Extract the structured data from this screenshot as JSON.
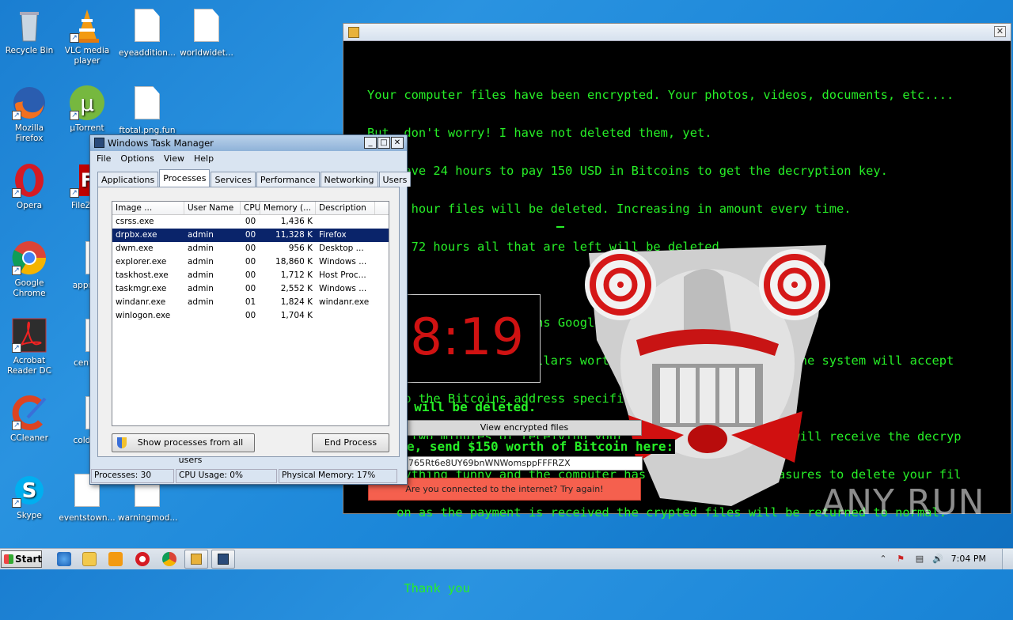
{
  "desktop": {
    "icons": [
      {
        "label": "Recycle Bin"
      },
      {
        "label": "VLC media player"
      },
      {
        "label": "eyeaddition..."
      },
      {
        "label": "worldwidet..."
      },
      {
        "label": "Mozilla Firefox"
      },
      {
        "label": "µTorrent"
      },
      {
        "label": "ftotal.png.fun"
      },
      {
        "label": "Opera"
      },
      {
        "label": "FileZilla"
      },
      {
        "label": "Google Chrome"
      },
      {
        "label": "approv"
      },
      {
        "label": "Acrobat Reader DC"
      },
      {
        "label": "center"
      },
      {
        "label": "CCleaner"
      },
      {
        "label": "coldne"
      },
      {
        "label": "Skype"
      },
      {
        "label": "eventstown..."
      },
      {
        "label": "warningmod..."
      }
    ]
  },
  "ransom": {
    "message_lines": [
      "Your computer files have been encrypted. Your photos, videos, documents, etc....",
      "But, don't worry! I have not deleted them, yet.",
      "You have 24 hours to pay 150 USD in Bitcoins to get the decryption key.",
      "Every hour files will be deleted. Increasing in amount every time.",
      "After 72 hours all that are left will be deleted.",
      "",
      "   u do not have bitcoins Google the website localbitcoins.",
      "    ase 150 American Dollars worth of Bitcoins or .4 BTC. The system will accept",
      "    to the Bitcoins address specified.",
      "    n two minutes of receiving your payment your computer will receive the decryp",
      "    nything funny and the computer has several safety measures to delete your fil",
      "    on as the payment is received the crypted files will be returned to normal.",
      "",
      "     Thank you"
    ],
    "timer": "8:19",
    "deleted_text": "e will be deleted.",
    "view_button": "View encrypted files",
    "send_text": "e, send $150 worth of Bitcoin here:",
    "address": "765Rt6e8UY69bnWNWomsppFFFRZX",
    "error_button": "Are you connected to the internet? Try again!",
    "close_glyph": "✕"
  },
  "taskmanager": {
    "title": "Windows Task Manager",
    "menu": [
      "File",
      "Options",
      "View",
      "Help"
    ],
    "tabs": [
      "Applications",
      "Processes",
      "Services",
      "Performance",
      "Networking",
      "Users"
    ],
    "columns": [
      "Image ...",
      "User Name",
      "CPU",
      "Memory (...",
      "Description"
    ],
    "rows": [
      {
        "image": "csrss.exe",
        "user": "",
        "cpu": "00",
        "mem": "1,436 K",
        "desc": ""
      },
      {
        "image": "drpbx.exe",
        "user": "admin",
        "cpu": "00",
        "mem": "11,328 K",
        "desc": "Firefox"
      },
      {
        "image": "dwm.exe",
        "user": "admin",
        "cpu": "00",
        "mem": "956 K",
        "desc": "Desktop ..."
      },
      {
        "image": "explorer.exe",
        "user": "admin",
        "cpu": "00",
        "mem": "18,860 K",
        "desc": "Windows ..."
      },
      {
        "image": "taskhost.exe",
        "user": "admin",
        "cpu": "00",
        "mem": "1,712 K",
        "desc": "Host Proc..."
      },
      {
        "image": "taskmgr.exe",
        "user": "admin",
        "cpu": "00",
        "mem": "2,552 K",
        "desc": "Windows ..."
      },
      {
        "image": "windanr.exe",
        "user": "admin",
        "cpu": "01",
        "mem": "1,824 K",
        "desc": "windanr.exe"
      },
      {
        "image": "winlogon.exe",
        "user": "",
        "cpu": "00",
        "mem": "1,704 K",
        "desc": ""
      }
    ],
    "show_all_button": "Show processes from all users",
    "end_process_button": "End Process",
    "status": {
      "processes": "Processes: 30",
      "cpu": "CPU Usage: 0%",
      "memory": "Physical Memory: 17%"
    }
  },
  "taskbar": {
    "start_label": "Start",
    "clock": "7:04 PM"
  },
  "watermark": "ANY RUN",
  "colors": {
    "terminal_green": "#27ef27",
    "timer_red": "#d01212",
    "error_bg": "#f5604e",
    "selection": "#0a246a"
  }
}
